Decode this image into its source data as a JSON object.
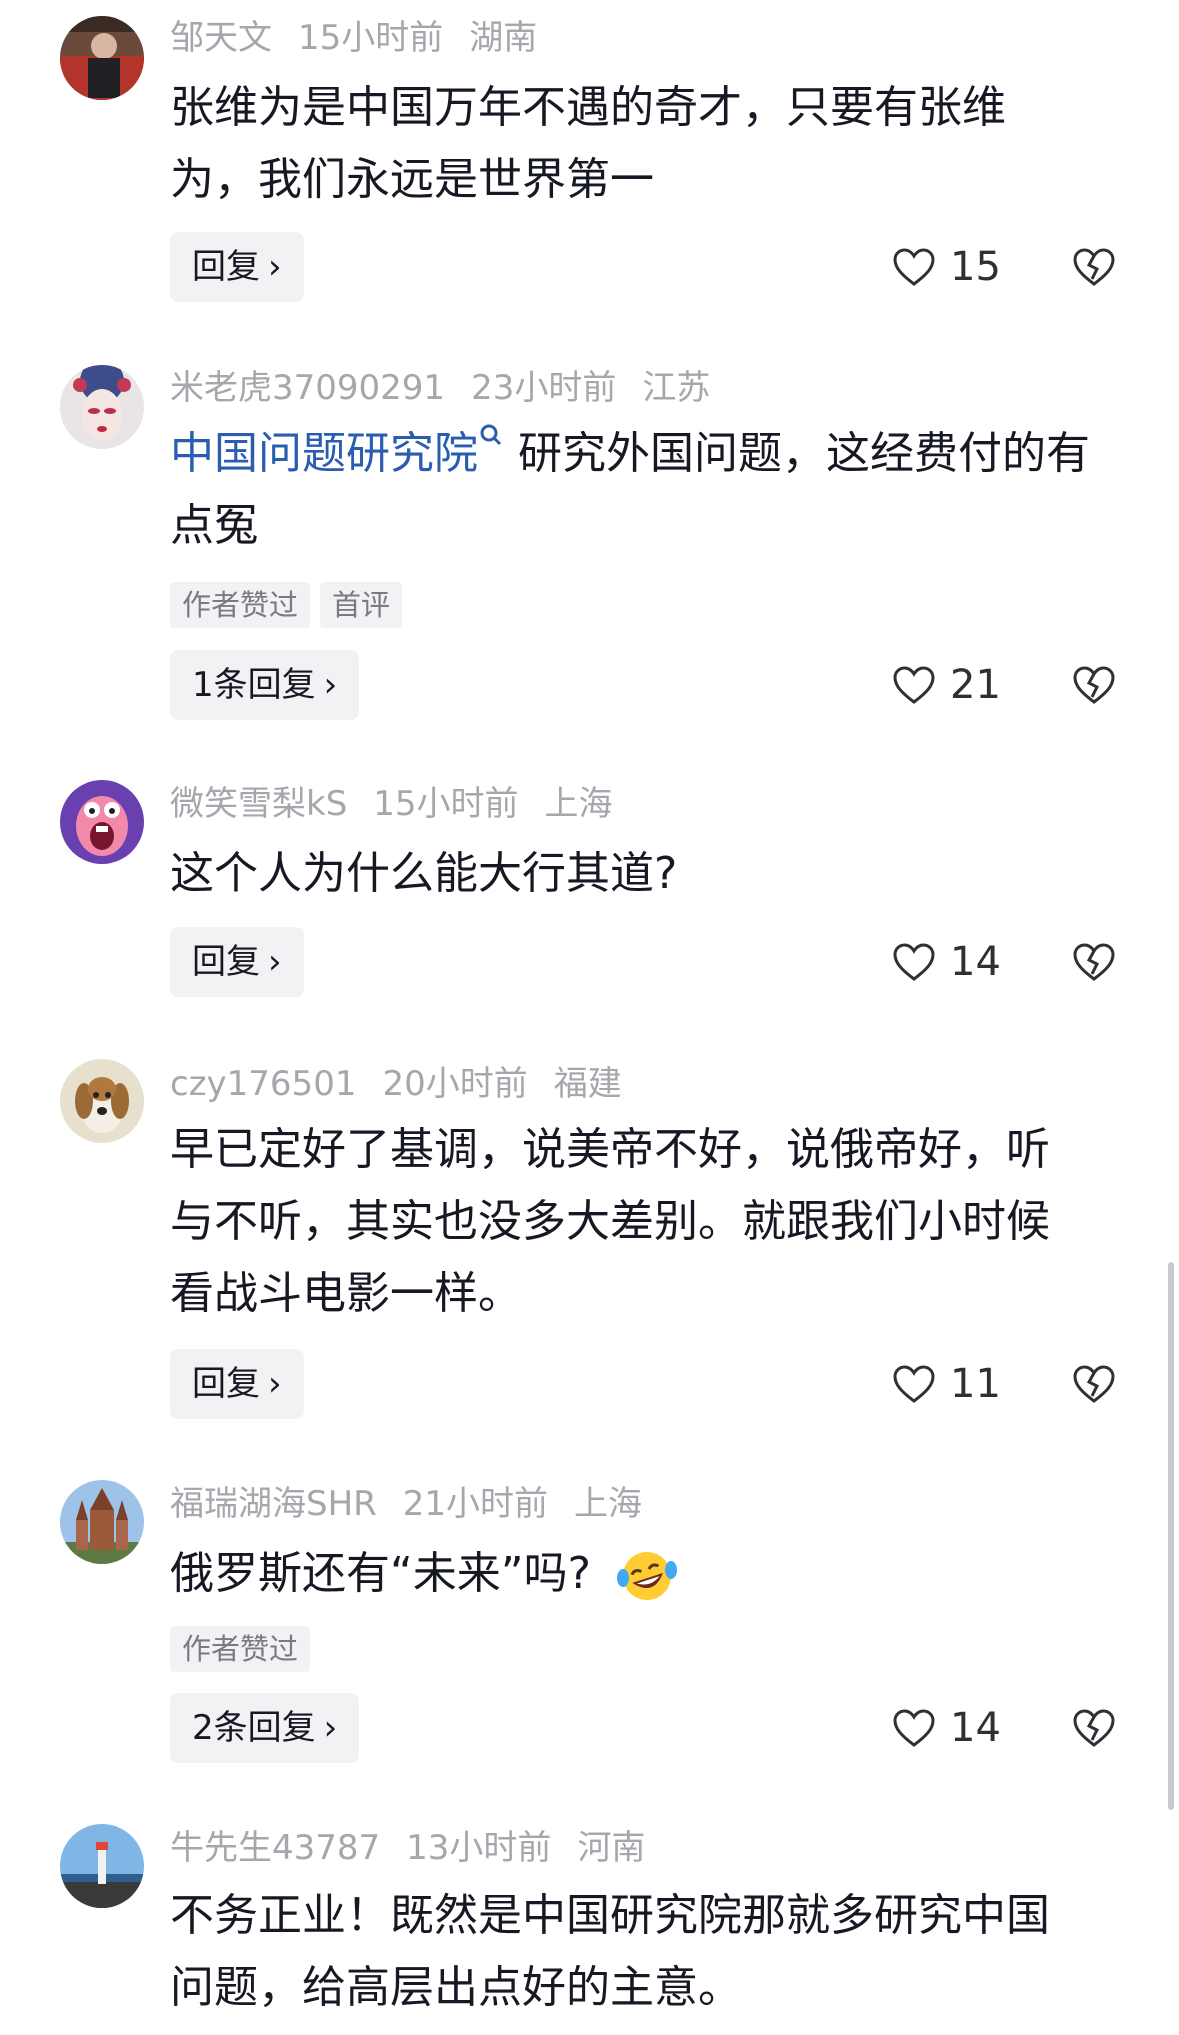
{
  "comments": [
    {
      "username": "邹天文",
      "time": "15小时前",
      "location": "湖南",
      "text": "张维为是中国万年不遇的奇才，只要有张维为，我们永远是世界第一",
      "reply_label": "回复",
      "likes": "15",
      "avatar_icon": "avatar-photo-person"
    },
    {
      "username": "米老虎37090291",
      "time": "23小时前",
      "location": "江苏",
      "mention": "中国问题研究院",
      "text": "研究外国问题，这经费付的有点冤",
      "tags": [
        "作者赞过",
        "首评"
      ],
      "reply_label": "1条回复",
      "likes": "21",
      "avatar_icon": "avatar-opera-mask"
    },
    {
      "username": "微笑雪梨kS",
      "time": "15小时前",
      "location": "上海",
      "text": "这个人为什么能大行其道?",
      "reply_label": "回复",
      "likes": "14",
      "avatar_icon": "avatar-cartoon-face"
    },
    {
      "username": "czy176501",
      "time": "20小时前",
      "location": "福建",
      "text": "早已定好了基调，说美帝不好，说俄帝好，听与不听，其实也没多大差别。就跟我们小时候看战斗电影一样。",
      "reply_label": "回复",
      "likes": "11",
      "avatar_icon": "avatar-dog"
    },
    {
      "username": "福瑞湖海SHR",
      "time": "21小时前",
      "location": "上海",
      "text": "俄罗斯还有“未来”吗?",
      "tags": [
        "作者赞过"
      ],
      "reply_label": "2条回复",
      "likes": "14",
      "avatar_icon": "avatar-cathedral",
      "emoji_icon": "laughing-crying-emoji"
    },
    {
      "username": "牛先生43787",
      "time": "13小时前",
      "location": "河南",
      "text": "不务正业！既然是中国研究院那就多研究中国问题，给高层出点好的主意。",
      "avatar_icon": "avatar-lighthouse"
    }
  ],
  "colors": {
    "meta": "#a6a7ac",
    "mention": "#2a5db0",
    "button_bg": "#f2f2f4",
    "text": "#161823"
  }
}
